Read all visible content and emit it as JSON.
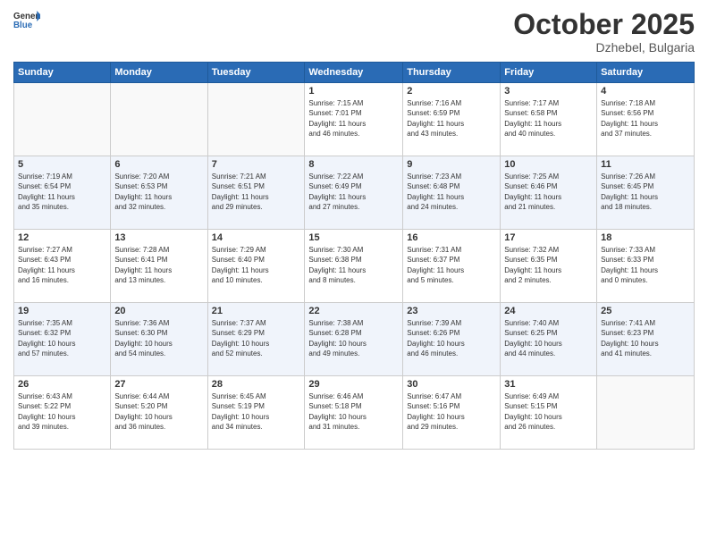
{
  "header": {
    "logo_general": "General",
    "logo_blue": "Blue",
    "month_title": "October 2025",
    "location": "Dzhebel, Bulgaria"
  },
  "weekdays": [
    "Sunday",
    "Monday",
    "Tuesday",
    "Wednesday",
    "Thursday",
    "Friday",
    "Saturday"
  ],
  "weeks": [
    [
      {
        "day": "",
        "info": ""
      },
      {
        "day": "",
        "info": ""
      },
      {
        "day": "",
        "info": ""
      },
      {
        "day": "1",
        "info": "Sunrise: 7:15 AM\nSunset: 7:01 PM\nDaylight: 11 hours\nand 46 minutes."
      },
      {
        "day": "2",
        "info": "Sunrise: 7:16 AM\nSunset: 6:59 PM\nDaylight: 11 hours\nand 43 minutes."
      },
      {
        "day": "3",
        "info": "Sunrise: 7:17 AM\nSunset: 6:58 PM\nDaylight: 11 hours\nand 40 minutes."
      },
      {
        "day": "4",
        "info": "Sunrise: 7:18 AM\nSunset: 6:56 PM\nDaylight: 11 hours\nand 37 minutes."
      }
    ],
    [
      {
        "day": "5",
        "info": "Sunrise: 7:19 AM\nSunset: 6:54 PM\nDaylight: 11 hours\nand 35 minutes."
      },
      {
        "day": "6",
        "info": "Sunrise: 7:20 AM\nSunset: 6:53 PM\nDaylight: 11 hours\nand 32 minutes."
      },
      {
        "day": "7",
        "info": "Sunrise: 7:21 AM\nSunset: 6:51 PM\nDaylight: 11 hours\nand 29 minutes."
      },
      {
        "day": "8",
        "info": "Sunrise: 7:22 AM\nSunset: 6:49 PM\nDaylight: 11 hours\nand 27 minutes."
      },
      {
        "day": "9",
        "info": "Sunrise: 7:23 AM\nSunset: 6:48 PM\nDaylight: 11 hours\nand 24 minutes."
      },
      {
        "day": "10",
        "info": "Sunrise: 7:25 AM\nSunset: 6:46 PM\nDaylight: 11 hours\nand 21 minutes."
      },
      {
        "day": "11",
        "info": "Sunrise: 7:26 AM\nSunset: 6:45 PM\nDaylight: 11 hours\nand 18 minutes."
      }
    ],
    [
      {
        "day": "12",
        "info": "Sunrise: 7:27 AM\nSunset: 6:43 PM\nDaylight: 11 hours\nand 16 minutes."
      },
      {
        "day": "13",
        "info": "Sunrise: 7:28 AM\nSunset: 6:41 PM\nDaylight: 11 hours\nand 13 minutes."
      },
      {
        "day": "14",
        "info": "Sunrise: 7:29 AM\nSunset: 6:40 PM\nDaylight: 11 hours\nand 10 minutes."
      },
      {
        "day": "15",
        "info": "Sunrise: 7:30 AM\nSunset: 6:38 PM\nDaylight: 11 hours\nand 8 minutes."
      },
      {
        "day": "16",
        "info": "Sunrise: 7:31 AM\nSunset: 6:37 PM\nDaylight: 11 hours\nand 5 minutes."
      },
      {
        "day": "17",
        "info": "Sunrise: 7:32 AM\nSunset: 6:35 PM\nDaylight: 11 hours\nand 2 minutes."
      },
      {
        "day": "18",
        "info": "Sunrise: 7:33 AM\nSunset: 6:33 PM\nDaylight: 11 hours\nand 0 minutes."
      }
    ],
    [
      {
        "day": "19",
        "info": "Sunrise: 7:35 AM\nSunset: 6:32 PM\nDaylight: 10 hours\nand 57 minutes."
      },
      {
        "day": "20",
        "info": "Sunrise: 7:36 AM\nSunset: 6:30 PM\nDaylight: 10 hours\nand 54 minutes."
      },
      {
        "day": "21",
        "info": "Sunrise: 7:37 AM\nSunset: 6:29 PM\nDaylight: 10 hours\nand 52 minutes."
      },
      {
        "day": "22",
        "info": "Sunrise: 7:38 AM\nSunset: 6:28 PM\nDaylight: 10 hours\nand 49 minutes."
      },
      {
        "day": "23",
        "info": "Sunrise: 7:39 AM\nSunset: 6:26 PM\nDaylight: 10 hours\nand 46 minutes."
      },
      {
        "day": "24",
        "info": "Sunrise: 7:40 AM\nSunset: 6:25 PM\nDaylight: 10 hours\nand 44 minutes."
      },
      {
        "day": "25",
        "info": "Sunrise: 7:41 AM\nSunset: 6:23 PM\nDaylight: 10 hours\nand 41 minutes."
      }
    ],
    [
      {
        "day": "26",
        "info": "Sunrise: 6:43 AM\nSunset: 5:22 PM\nDaylight: 10 hours\nand 39 minutes."
      },
      {
        "day": "27",
        "info": "Sunrise: 6:44 AM\nSunset: 5:20 PM\nDaylight: 10 hours\nand 36 minutes."
      },
      {
        "day": "28",
        "info": "Sunrise: 6:45 AM\nSunset: 5:19 PM\nDaylight: 10 hours\nand 34 minutes."
      },
      {
        "day": "29",
        "info": "Sunrise: 6:46 AM\nSunset: 5:18 PM\nDaylight: 10 hours\nand 31 minutes."
      },
      {
        "day": "30",
        "info": "Sunrise: 6:47 AM\nSunset: 5:16 PM\nDaylight: 10 hours\nand 29 minutes."
      },
      {
        "day": "31",
        "info": "Sunrise: 6:49 AM\nSunset: 5:15 PM\nDaylight: 10 hours\nand 26 minutes."
      },
      {
        "day": "",
        "info": ""
      }
    ]
  ]
}
